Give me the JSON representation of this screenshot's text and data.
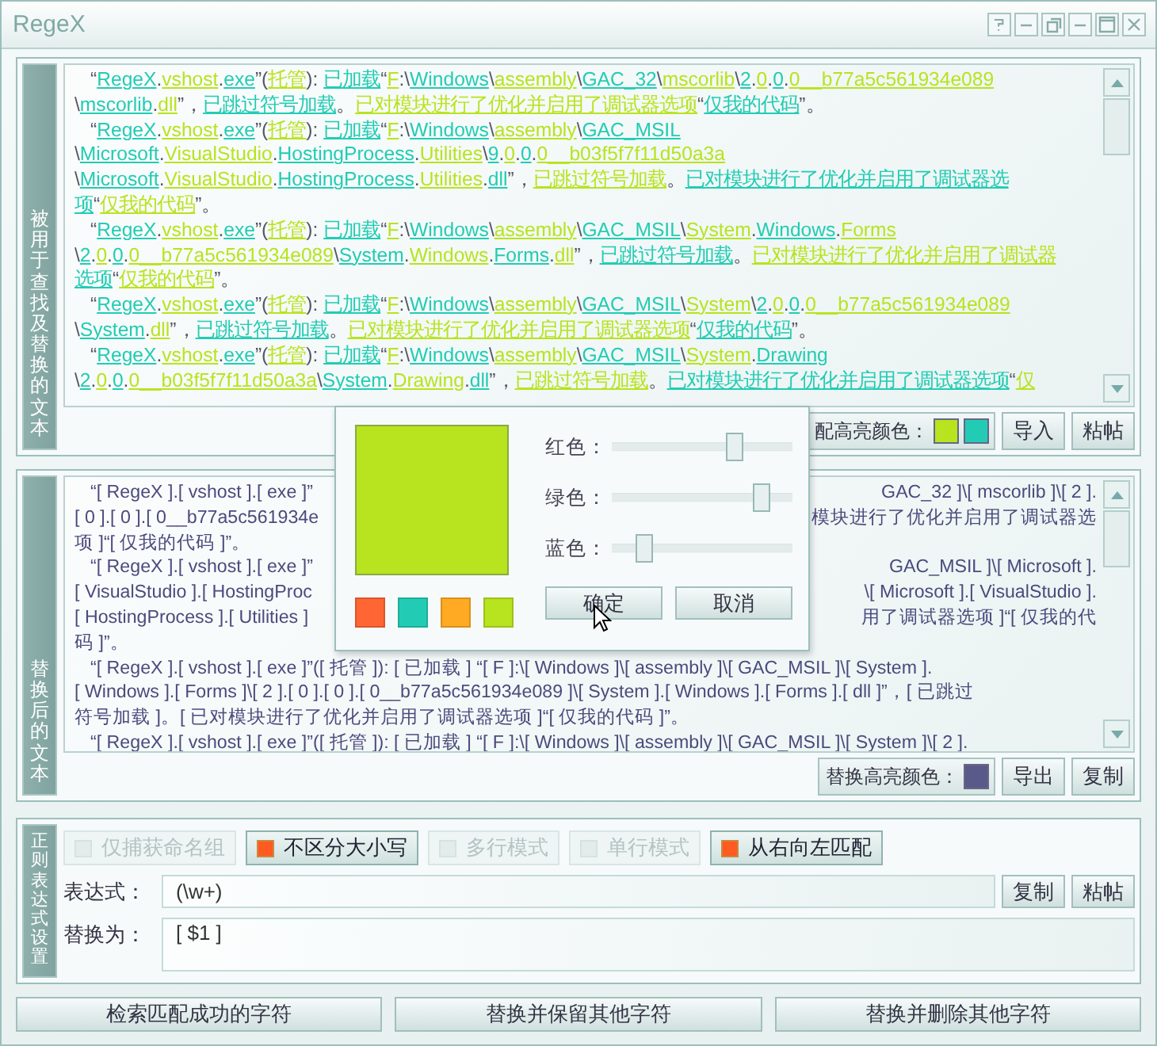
{
  "window": {
    "title": "RegeX"
  },
  "title_buttons": [
    {
      "kind": "help"
    },
    {
      "kind": "collapse"
    },
    {
      "kind": "restore"
    },
    {
      "kind": "minimize"
    },
    {
      "kind": "maximize"
    },
    {
      "kind": "close"
    }
  ],
  "source_panel": {
    "label": "被用于查找及替换的文本",
    "lines": [
      {
        "text": "“RegeX.vshost.exe”(托管): 已加载“F:\\Windows\\assembly\\GAC_32\\mscorlib\\2.0.0.0__b77a5c561934e089",
        "indent": true
      },
      {
        "text": "\\mscorlib.dll”，已跳过符号加载。已对模块进行了优化并启用了调试器选项“仅我的代码”。",
        "indent": false
      },
      {
        "text": "“RegeX.vshost.exe”(托管): 已加载“F:\\Windows\\assembly\\GAC_MSIL",
        "indent": true
      },
      {
        "text": "\\Microsoft.VisualStudio.HostingProcess.Utilities\\9.0.0.0__b03f5f7f11d50a3a",
        "indent": false
      },
      {
        "text": "\\Microsoft.VisualStudio.HostingProcess.Utilities.dll”，已跳过符号加载。已对模块进行了优化并启用了调试器选",
        "indent": false
      },
      {
        "text": "项“仅我的代码”。",
        "indent": false
      },
      {
        "text": "“RegeX.vshost.exe”(托管): 已加载“F:\\Windows\\assembly\\GAC_MSIL\\System.Windows.Forms",
        "indent": true
      },
      {
        "text": "\\2.0.0.0__b77a5c561934e089\\System.Windows.Forms.dll”，已跳过符号加载。已对模块进行了优化并启用了调试器",
        "indent": false
      },
      {
        "text": "选项“仅我的代码”。",
        "indent": false
      },
      {
        "text": "“RegeX.vshost.exe”(托管): 已加载“F:\\Windows\\assembly\\GAC_MSIL\\System\\2.0.0.0__b77a5c561934e089",
        "indent": true
      },
      {
        "text": "\\System.dll”，已跳过符号加载。已对模块进行了优化并启用了调试器选项“仅我的代码”。",
        "indent": false
      },
      {
        "text": "“RegeX.vshost.exe”(托管): 已加载“F:\\Windows\\assembly\\GAC_MSIL\\System.Drawing",
        "indent": true
      },
      {
        "text": "\\2.0.0.0__b03f5f7f11d50a3a\\System.Drawing.dll”，已跳过符号加载。已对模块进行了优化并启用了调试器选项“仅",
        "indent": false
      }
    ],
    "highlight_label": "配高亮颜色：",
    "highlight_colors": [
      {
        "color": "#b8e31f"
      },
      {
        "color": "#22ccb4"
      }
    ],
    "buttons": [
      "导入",
      "粘帖"
    ]
  },
  "result_panel": {
    "label": "替换后的文本",
    "lines": [
      {
        "left": "“[ RegeX ].[ vshost ].[ exe ]”",
        "right": "GAC_32 ]\\[ mscorlib ]\\[ 2 ].",
        "indent": true
      },
      {
        "left": "[ 0 ].[ 0 ].[ 0__b77a5c561934e",
        "right": "模块进行了优化并启用了调试器选",
        "indent": false
      },
      {
        "left": "项 ]“[ 仅我的代码 ]”。",
        "indent": false
      },
      {
        "left": "“[ RegeX ].[ vshost ].[ exe ]”",
        "right": "GAC_MSIL ]\\[ Microsoft ].",
        "indent": true
      },
      {
        "left": "[ VisualStudio ].[ HostingProc",
        "right": "\\[ Microsoft ].[ VisualStudio ].",
        "indent": false
      },
      {
        "left": "[ HostingProcess ].[ Utilities ]",
        "right": "用了调试器选项 ]“[ 仅我的代",
        "indent": false
      },
      {
        "left": "码 ]”。",
        "indent": false
      },
      {
        "left": "“[ RegeX ].[ vshost ].[ exe ]”([ 托管 ]): [ 已加载 ] “[ F ]:\\[ Windows ]\\[ assembly ]\\[ GAC_MSIL ]\\[ System ].",
        "indent": true
      },
      {
        "left": "[ Windows ].[ Forms ]\\[ 2 ].[ 0 ].[ 0 ].[ 0__b77a5c561934e089 ]\\[ System ].[ Windows ].[ Forms ].[ dll ]”，[ 已跳过",
        "indent": false
      },
      {
        "left": "符号加载 ]。[ 已对模块进行了优化并启用了调试器选项 ]“[ 仅我的代码 ]”。",
        "indent": false
      },
      {
        "left": "“[ RegeX ].[ vshost ].[ exe ]”([ 托管 ]): [ 已加载 ] “[ F ]:\\[ Windows ]\\[ assembly ]\\[ GAC_MSIL ]\\[ System ]\\[ 2 ].",
        "indent": true
      }
    ],
    "highlight_label": "替换高亮颜色：",
    "highlight_colors": [
      {
        "color": "#5a5a8a"
      }
    ],
    "buttons": [
      "导出",
      "复制"
    ]
  },
  "regex_panel": {
    "label": "正则表达式设置",
    "options": [
      {
        "label": "仅捕获命名组",
        "checked": false
      },
      {
        "label": "不区分大小写",
        "checked": true
      },
      {
        "label": "多行模式",
        "checked": false
      },
      {
        "label": "单行模式",
        "checked": false
      },
      {
        "label": "从右向左匹配",
        "checked": true
      }
    ],
    "expression_label": "表达式：",
    "expression": "(\\w+)",
    "expression_buttons": [
      "复制",
      "粘帖"
    ],
    "replace_label": "替换为：",
    "replacement": "[ $1 ]"
  },
  "actions": [
    "检索匹配成功的字符",
    "替换并保留其他字符",
    "替换并删除其他字符"
  ],
  "color_dialog": {
    "color": "#b8e31f",
    "sliders": [
      {
        "label": "红色：",
        "level": 0.68
      },
      {
        "label": "绿色：",
        "level": 0.83
      },
      {
        "label": "蓝色：",
        "level": 0.18
      }
    ],
    "swatches": [
      {
        "color": "#ff6633"
      },
      {
        "color": "#22ccb4"
      },
      {
        "color": "#ffaa22"
      },
      {
        "color": "#b8e31f"
      }
    ],
    "buttons": [
      "确定",
      "取消"
    ]
  }
}
